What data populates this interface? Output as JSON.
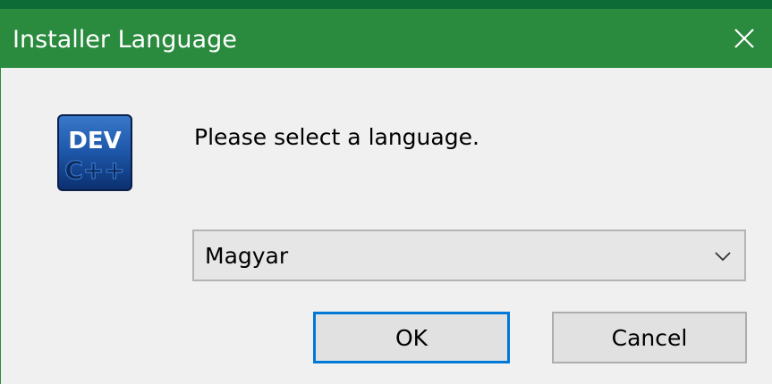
{
  "window": {
    "title": "Installer Language",
    "close_icon": "close-icon",
    "title_color": "#2a8a3e"
  },
  "app_icon": {
    "name": "dev-cpp-icon",
    "line1": "DEV",
    "line2": "C++"
  },
  "dialog": {
    "prompt": "Please select a language.",
    "language_select": {
      "selected": "Magyar",
      "chevron_icon": "chevron-down-icon"
    },
    "buttons": {
      "ok_label": "OK",
      "cancel_label": "Cancel"
    },
    "accent_color": "#0078d7"
  }
}
